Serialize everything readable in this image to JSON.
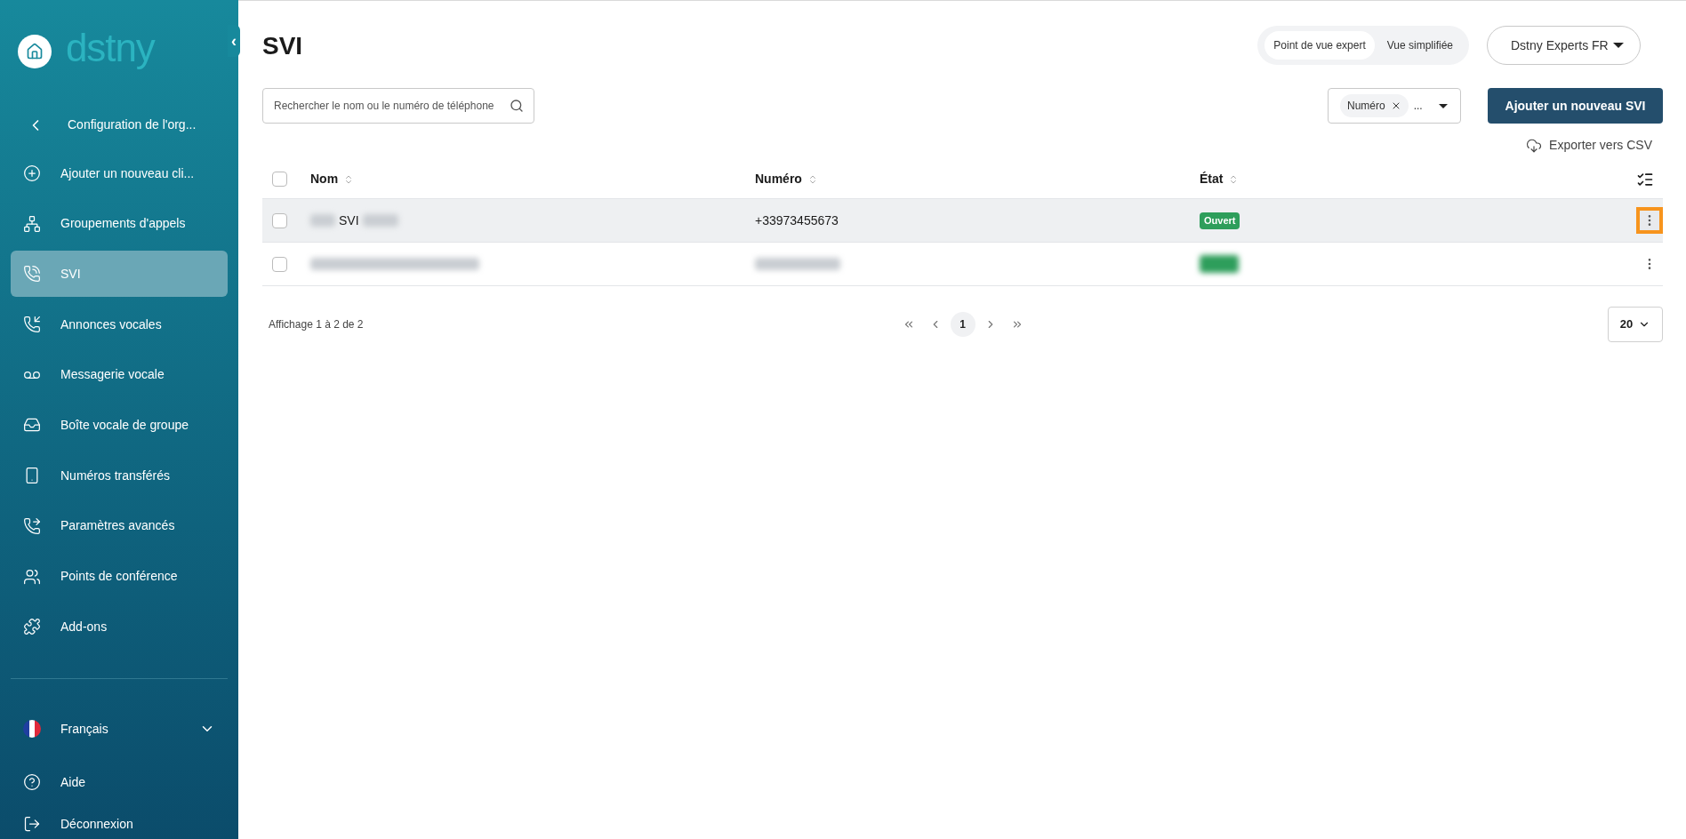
{
  "sidebar": {
    "logo": "dstny",
    "collapse_label": "‹",
    "back_item": "Configuration de l'org...",
    "items": [
      {
        "label": "Ajouter un nouveau cli...",
        "selected": false
      },
      {
        "label": "Groupements d'appels",
        "selected": false
      },
      {
        "label": "SVI",
        "selected": true
      },
      {
        "label": "Annonces vocales",
        "selected": false
      },
      {
        "label": "Messagerie vocale",
        "selected": false
      },
      {
        "label": "Boîte vocale de groupe",
        "selected": false
      },
      {
        "label": "Numéros transférés",
        "selected": false
      },
      {
        "label": "Paramètres avancés",
        "selected": false
      },
      {
        "label": "Points de conférence",
        "selected": false
      },
      {
        "label": "Add-ons",
        "selected": false
      }
    ],
    "language": "Français",
    "help": "Aide",
    "logout": "Déconnexion"
  },
  "page_title": "SVI",
  "view_toggle": [
    {
      "label": "Point de vue expert",
      "selected": true
    },
    {
      "label": "Vue simplifiée",
      "selected": false
    }
  ],
  "account": "Dstny Experts FR",
  "search": {
    "placeholder": "Rechercher le nom ou le numéro de téléphone"
  },
  "column_filter": {
    "chip": "Numéro",
    "more": "..."
  },
  "add_button": "Ajouter un nouveau SVI",
  "export_link": "Exporter vers CSV",
  "table": {
    "select_all_checked": false,
    "columns": [
      "Nom",
      "Numéro",
      "État"
    ],
    "rows": [
      {
        "checked": false,
        "hovered": true,
        "name_parts": [
          {
            "kind": "redacted"
          },
          {
            "kind": "text",
            "text": "SVI"
          },
          {
            "kind": "redacted"
          }
        ],
        "number": {
          "kind": "text",
          "text": "+33973455673"
        },
        "status": {
          "kind": "badge",
          "text": "Ouvert",
          "color": "#2e9e5b"
        },
        "actions_highlighted": true
      },
      {
        "checked": false,
        "hovered": false,
        "name_parts": [
          {
            "kind": "redacted"
          }
        ],
        "number": {
          "kind": "redacted"
        },
        "status": {
          "kind": "redacted",
          "color": "#2e9e5b"
        },
        "actions_highlighted": false
      }
    ]
  },
  "pagination": {
    "summary": "Affichage 1 à 2 de 2",
    "pages": [
      {
        "label": "1",
        "selected": true
      }
    ],
    "page_size": "20"
  }
}
